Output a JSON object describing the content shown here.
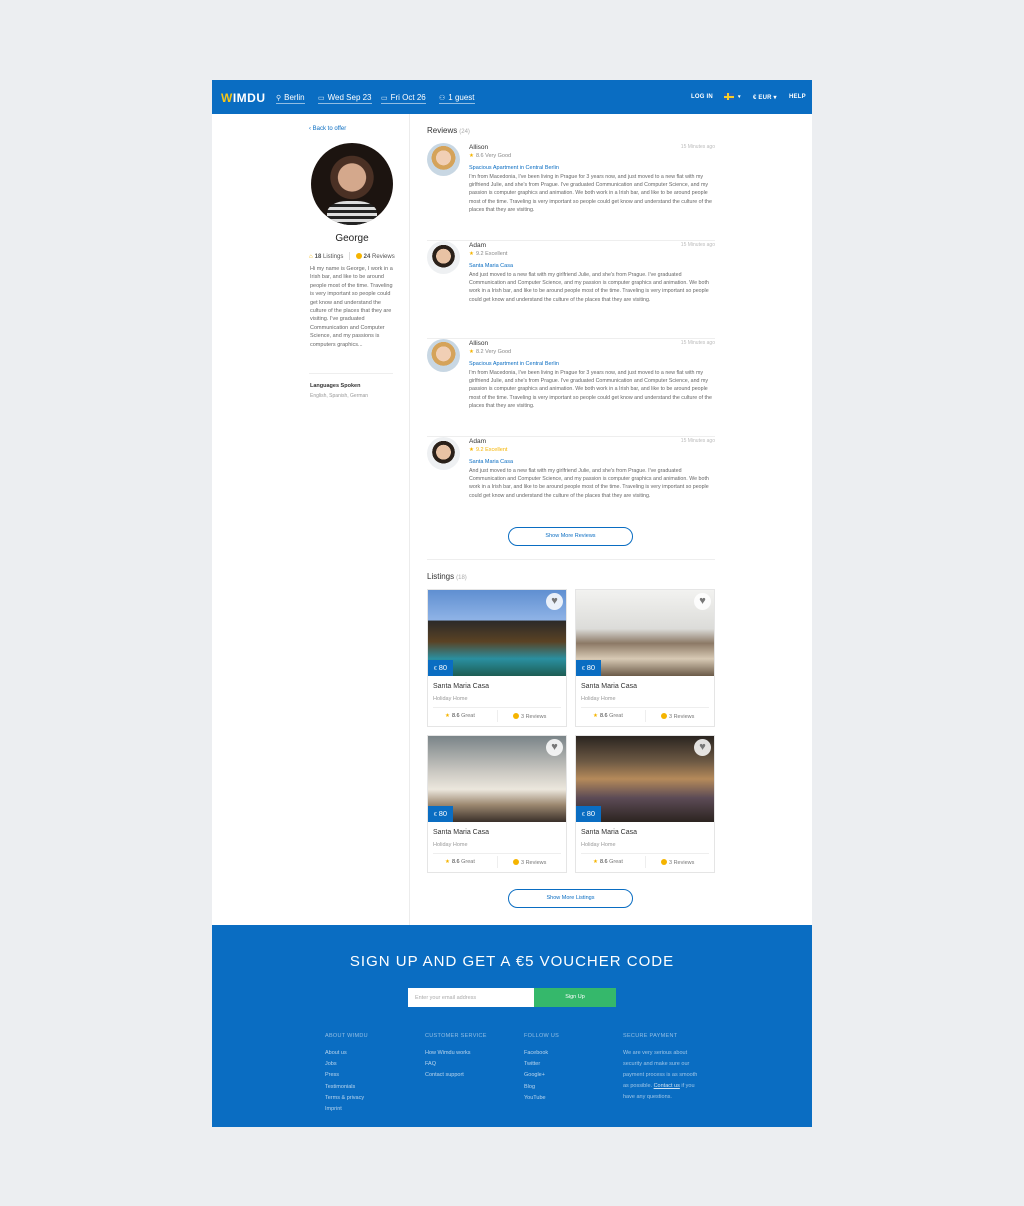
{
  "header": {
    "logo": "WIMDU",
    "location": "Berlin",
    "checkin": "Wed Sep 23",
    "checkout": "Fri Oct 26",
    "guests": "1 guest",
    "login": "LOG IN",
    "currency": "€ EUR",
    "help": "HELP",
    "brand_color": "#0a6dc2"
  },
  "profile": {
    "back": "‹ Back to offer",
    "name": "George",
    "listings_count": "18",
    "listings_label": "Listings",
    "reviews_count": "24",
    "reviews_label": "Reviews",
    "bio": "Hi my name is George, I work in a Irish bar, and like to be around people most of the time.  Traveling is very important so people could get know and understand the culture of the places that they are visiting. I've graduated Communication and Computer Science, and my passions is computers graphics...",
    "languages_title": "Languages Spoken",
    "languages": "English, Spanish, German"
  },
  "reviews": {
    "title": "Reviews",
    "count": "(24)",
    "items": [
      {
        "name": "Allison",
        "time": "15 Minutes ago",
        "rating": "8.6 Very Good",
        "listing": "Spacious Apartment in Central Berlin",
        "text": "I'm from Macedonia, I've been living in Prague for 3 years now, and just moved to a new flat with my girlfriend Julie, and she's from Prague.  I've graduated Communication and Computer Science, and my passion is computer graphics and animation.  We both work in a Irish bar, and like to be around people most of the time.  Traveling is very important so people could get know and understand the culture of the places that they are visiting."
      },
      {
        "name": "Adam",
        "time": "15 Minutes ago",
        "rating": "9.2 Excellent",
        "listing": "Santa Maria Casa",
        "text": "And just moved to a new flat with my girlfriend Julie, and she's from Prague.  I've graduated Communication and Computer Science, and my passion is computer graphics and animation.  We both work in a Irish bar, and like to be around people most of the time.  Traveling is very important so people could get know and understand the culture of the places that they are visiting."
      },
      {
        "name": "Allison",
        "time": "15 Minutes ago",
        "rating": "8.2 Very Good",
        "listing": "Spacious Apartment in Central Berlin",
        "text": "I'm from Macedonia, I've been living in Prague for 3 years now, and just moved to a new flat with my girlfriend Julie, and she's from Prague.  I've graduated Communication and Computer Science, and my passion is computer graphics and animation.  We both work in a Irish bar, and like to be around people most of the time.  Traveling is very important so people could get know and understand the culture of the places that they are visiting."
      },
      {
        "name": "Adam",
        "time": "15 Minutes ago",
        "rating": "9.2 Excellent",
        "listing": "Santa Maria Casa",
        "text": "And just moved to a new flat with my girlfriend Julie, and she's from Prague.  I've graduated Communication and Computer Science, and my passion is computer graphics and animation.  We both work in a Irish bar, and like to be around people most of the time.  Traveling is very important so people could get know and understand the culture of the places that they are visiting."
      }
    ],
    "show_more": "Show More Reviews"
  },
  "listings": {
    "title": "Listings",
    "count": "(18)",
    "items": [
      {
        "price": "80",
        "currency": "€",
        "title": "Santa Maria Casa",
        "type": "Holiday Home",
        "score": "8.6",
        "score_label": "Great",
        "reviews": "3 Reviews"
      },
      {
        "price": "80",
        "currency": "€",
        "title": "Santa Maria Casa",
        "type": "Holiday Home",
        "score": "8.6",
        "score_label": "Great",
        "reviews": "3 Reviews"
      },
      {
        "price": "80",
        "currency": "€",
        "title": "Santa Maria Casa",
        "type": "Holiday Home",
        "score": "8.6",
        "score_label": "Great",
        "reviews": "3 Reviews"
      },
      {
        "price": "80",
        "currency": "€",
        "title": "Santa Maria Casa",
        "type": "Holiday Home",
        "score": "8.6",
        "score_label": "Great",
        "reviews": "3 Reviews"
      }
    ],
    "show_more": "Show More Listings"
  },
  "footer": {
    "signup_title": "SIGN UP AND GET A €5 VOUCHER CODE",
    "email_placeholder": "Enter your email address",
    "signup_button": "Sign Up",
    "signup_color": "#35b86b",
    "about": {
      "title": "ABOUT WIMDU",
      "links": [
        "About us",
        "Jobs",
        "Press",
        "Testimonials",
        "Terms & privacy",
        "Imprint"
      ]
    },
    "service": {
      "title": "CUSTOMER SERVICE",
      "links": [
        "How Wimdu works",
        "FAQ",
        "Contact support"
      ]
    },
    "follow": {
      "title": "FOLLOW US",
      "links": [
        "Facebook",
        "Twitter",
        "Google+",
        "Blog",
        "YouTube"
      ]
    },
    "payment": {
      "title": "SECURE PAYMENT",
      "text": "We are very serious about security and make sure our payment process is as smooth as possible.",
      "contact_link": "Contact us",
      "contact_rest": " if you have any questions."
    }
  }
}
